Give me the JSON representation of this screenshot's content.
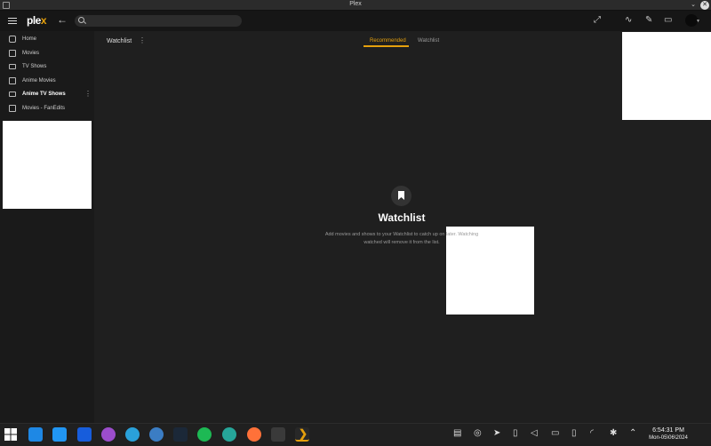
{
  "window": {
    "title": "Plex"
  },
  "topbar": {
    "logo_main": "ple",
    "logo_x": "x",
    "search_placeholder": ""
  },
  "sidebar": {
    "items": [
      {
        "label": "Home",
        "icon": "home-icon"
      },
      {
        "label": "Movies",
        "icon": "film-icon"
      },
      {
        "label": "TV Shows",
        "icon": "tv-icon"
      },
      {
        "label": "Anime Movies",
        "icon": "film-icon"
      },
      {
        "label": "Anime TV Shows",
        "icon": "tv-icon",
        "active": true
      },
      {
        "label": "Movies - FanEdits",
        "icon": "film-icon"
      }
    ]
  },
  "main": {
    "header_title": "Watchlist",
    "tabs": [
      {
        "label": "Recommended",
        "active": true
      },
      {
        "label": "Watchlist",
        "active": false
      }
    ],
    "empty_title": "Watchlist",
    "empty_text_line1": "Add movies and shows to your Watchlist to catch up on later. Watching",
    "empty_text_line2": "watched will remove it from the list."
  },
  "taskbar": {
    "time": "6:54:31 PM",
    "date": "Mon-05\\06\\2024"
  },
  "colors": {
    "accent": "#e5a00d",
    "background": "#1f1f1f",
    "sidebar": "#1a1a1a",
    "topbar": "#161616"
  }
}
